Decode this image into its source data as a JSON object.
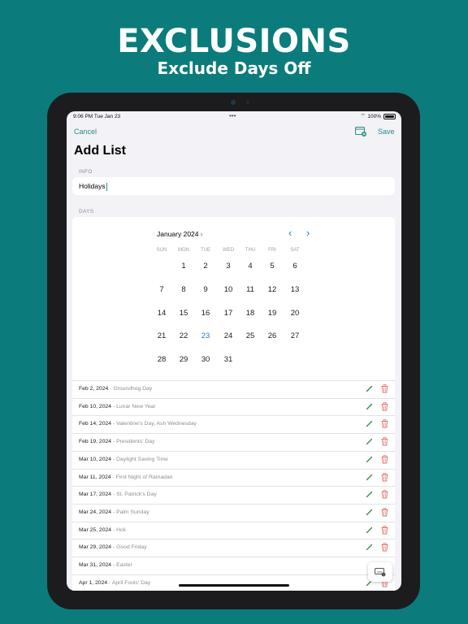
{
  "promo": {
    "title": "EXCLUSIONS",
    "subtitle": "Exclude Days Off"
  },
  "status": {
    "time": "9:06 PM  Tue Jan 23",
    "dots": "•••",
    "wifi": "⌔",
    "battery": "100%"
  },
  "nav": {
    "cancel": "Cancel",
    "save": "Save",
    "title": "Add List",
    "calendar_icon": "calendar-add-icon"
  },
  "info": {
    "label": "INFO",
    "value": "Holidays"
  },
  "days": {
    "label": "DAYS"
  },
  "calendar": {
    "month": "January 2024",
    "month_chevron": "›",
    "prev": "‹",
    "next": "›",
    "weekdays": [
      "SUN",
      "MON",
      "TUE",
      "WED",
      "THU",
      "FRI",
      "SAT"
    ],
    "weeks": [
      [
        "",
        "1",
        "2",
        "3",
        "4",
        "5",
        "6"
      ],
      [
        "7",
        "8",
        "9",
        "10",
        "11",
        "12",
        "13"
      ],
      [
        "14",
        "15",
        "16",
        "17",
        "18",
        "19",
        "20"
      ],
      [
        "21",
        "22",
        "23",
        "24",
        "25",
        "26",
        "27"
      ],
      [
        "28",
        "29",
        "30",
        "31",
        "",
        "",
        ""
      ]
    ],
    "today": "23"
  },
  "exclusions": [
    {
      "date": "Feb 2, 2024",
      "name": " - Groundhog Day",
      "editable": true
    },
    {
      "date": "Feb 10, 2024",
      "name": " - Lunar New Year",
      "editable": true
    },
    {
      "date": "Feb 14, 2024",
      "name": " - Valentine's Day, Ash Wednesday",
      "editable": true
    },
    {
      "date": "Feb 19, 2024",
      "name": " - Presidents' Day",
      "editable": true
    },
    {
      "date": "Mar 10, 2024",
      "name": " - Daylight Saving Time",
      "editable": true
    },
    {
      "date": "Mar 11, 2024",
      "name": " - First Night of Ramadan",
      "editable": true
    },
    {
      "date": "Mar 17, 2024",
      "name": " - St. Patrick's Day",
      "editable": true
    },
    {
      "date": "Mar 24, 2024",
      "name": " - Palm Sunday",
      "editable": true
    },
    {
      "date": "Mar 25, 2024",
      "name": " - Holi",
      "editable": true
    },
    {
      "date": "Mar 29, 2024",
      "name": " - Good Friday",
      "editable": true
    },
    {
      "date": "Mar 31, 2024",
      "name": " - Easter",
      "editable": false
    },
    {
      "date": "Apr 1, 2024",
      "name": " - April Fools' Day",
      "editable": true
    }
  ],
  "colors": {
    "background": "#0b7c7b",
    "accent": "#2a8a88",
    "today": "#2a7ad0",
    "delete": "#e36a6a",
    "edit": "#2f8a5a"
  },
  "icons": {
    "edit": "pencil-icon",
    "delete": "trash-icon",
    "keyboard": "keyboard-icon"
  }
}
